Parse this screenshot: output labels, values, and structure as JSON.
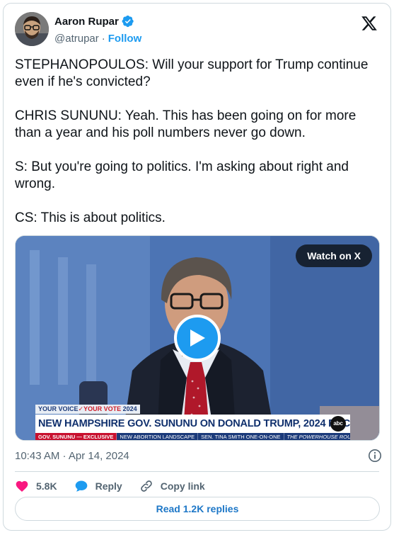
{
  "author": {
    "display_name": "Aaron Rupar",
    "handle": "@atrupar",
    "separator": "·",
    "follow_label": "Follow",
    "verified": true
  },
  "tweet": {
    "text": "STEPHANOPOULOS: Will your support for Trump continue even if he's convicted?\n\nCHRIS SUNUNU: Yeah. This has been going on for more than a year and his poll numbers never go down.\n\nS: But you're going to politics. I'm asking about right and wrong.\n\nCS: This is about politics."
  },
  "media": {
    "watch_label": "Watch on X",
    "lower_third": {
      "kicker_a": "YOUR VOICE",
      "kicker_b": "YOUR VOTE",
      "kicker_year": "2024",
      "headline": "NEW HAMPSHIRE GOV. SUNUNU ON DONALD TRUMP, 2024 RACE",
      "network": "abc",
      "ticker": [
        "GOV. SUNUNU — EXCLUSIVE",
        "NEW ABORTION LANDSCAPE",
        "SEN. TINA SMITH ONE-ON-ONE",
        "THE POWERHOUSE ROUNDTABLE"
      ]
    }
  },
  "meta": {
    "timestamp": "10:43 AM · Apr 14, 2024"
  },
  "actions": {
    "like_count": "5.8K",
    "reply_label": "Reply",
    "copy_label": "Copy link"
  },
  "read_replies_label": "Read 1.2K replies",
  "icons": {
    "x_logo": "x-logo-icon",
    "verified": "verified-badge-icon",
    "play": "play-icon",
    "info": "info-icon",
    "heart": "heart-icon",
    "reply": "reply-bubble-icon",
    "link": "link-icon"
  },
  "colors": {
    "accent": "#1d9bf0",
    "like": "#f91880",
    "text": "#0f1419",
    "muted": "#536471",
    "border": "#cfd9de"
  }
}
